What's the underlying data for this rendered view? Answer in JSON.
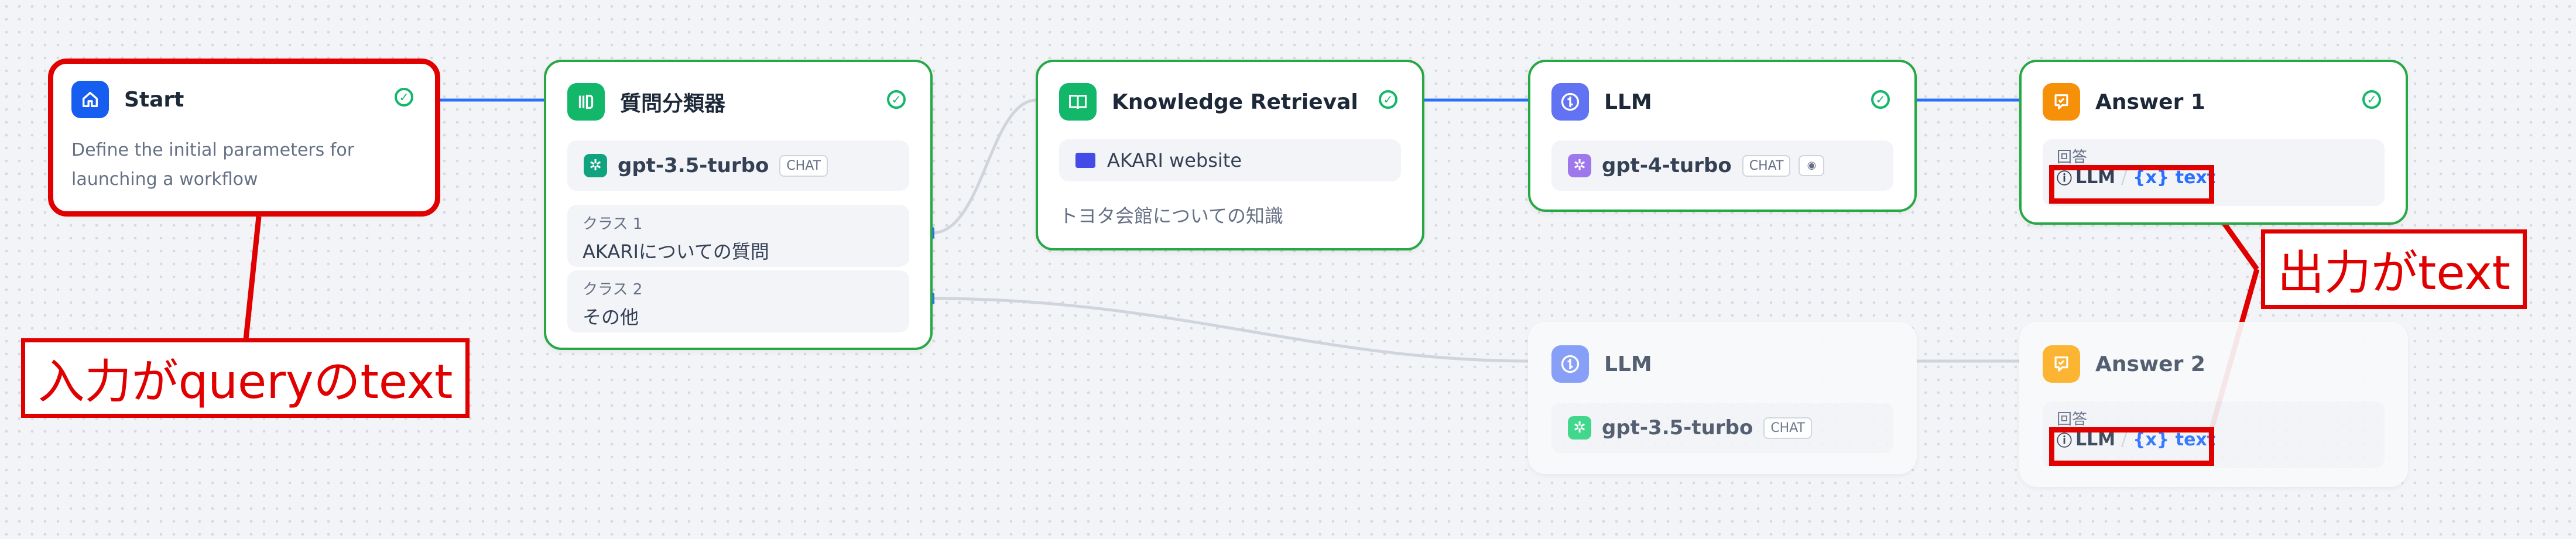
{
  "colors": {
    "accent_blue": "#2970ff",
    "success_green": "#28a745",
    "annotation_red": "#e00000"
  },
  "nodes": {
    "start": {
      "title": "Start",
      "desc_line1": "Define the initial parameters for",
      "desc_line2": "launching a workflow",
      "icon": "home-icon"
    },
    "classifier": {
      "title": "質問分類器",
      "model": "gpt-3.5-turbo",
      "model_tag": "CHAT",
      "class1_label": "クラス 1",
      "class1_text": "AKARIについての質問",
      "class2_label": "クラス 2",
      "class2_text": "その他",
      "icon": "classifier-icon"
    },
    "knowledge": {
      "title": "Knowledge Retrieval",
      "dataset": "AKARI website",
      "desc": "トヨタ会館についての知識",
      "icon": "book-icon"
    },
    "llm1": {
      "title": "LLM",
      "model": "gpt-4-turbo",
      "model_tag": "CHAT",
      "icon": "llm-icon"
    },
    "answer1": {
      "title": "Answer 1",
      "label": "回答",
      "var_node": "LLM",
      "var_name": "{x} text",
      "icon": "answer-icon"
    },
    "llm2": {
      "title": "LLM",
      "model": "gpt-3.5-turbo",
      "model_tag": "CHAT",
      "icon": "llm-icon"
    },
    "answer2": {
      "title": "Answer 2",
      "label": "回答",
      "var_node": "LLM",
      "var_name": "{x} text",
      "icon": "answer-icon"
    }
  },
  "annotations": {
    "input": "入力がqueryのtext",
    "output": "出力がtext"
  }
}
